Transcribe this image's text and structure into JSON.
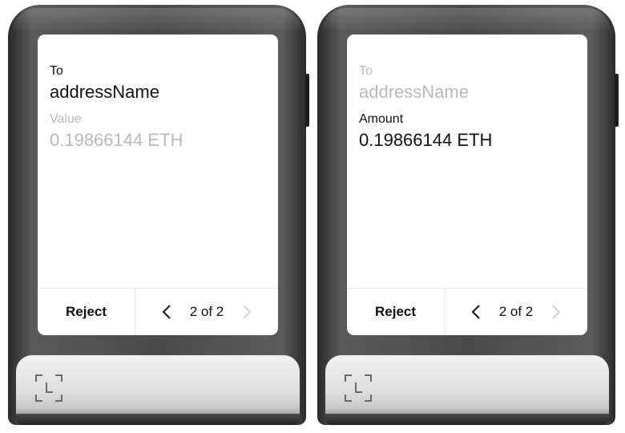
{
  "devices": [
    {
      "fields": [
        {
          "label": "To",
          "value": "addressName",
          "dimmed": false
        },
        {
          "label": "Value",
          "value": "0.19866144 ETH",
          "dimmed": true
        }
      ],
      "footer": {
        "reject_label": "Reject",
        "page_indicator": "2 of 2"
      }
    },
    {
      "fields": [
        {
          "label": "To",
          "value": "addressName",
          "dimmed": true
        },
        {
          "label": "Amount",
          "value": "0.19866144 ETH",
          "dimmed": false
        }
      ],
      "footer": {
        "reject_label": "Reject",
        "page_indicator": "2 of 2"
      }
    }
  ],
  "colors": {
    "text": "#111111",
    "dimmed_text": "#b9b9b9",
    "screen_bg": "#ffffff",
    "device_body": "#4a4a4a",
    "chin": "#e2e2e2"
  },
  "icons": {
    "prev": "chevron-left-icon",
    "next": "chevron-right-icon",
    "chin": "ledger-logo-icon"
  }
}
